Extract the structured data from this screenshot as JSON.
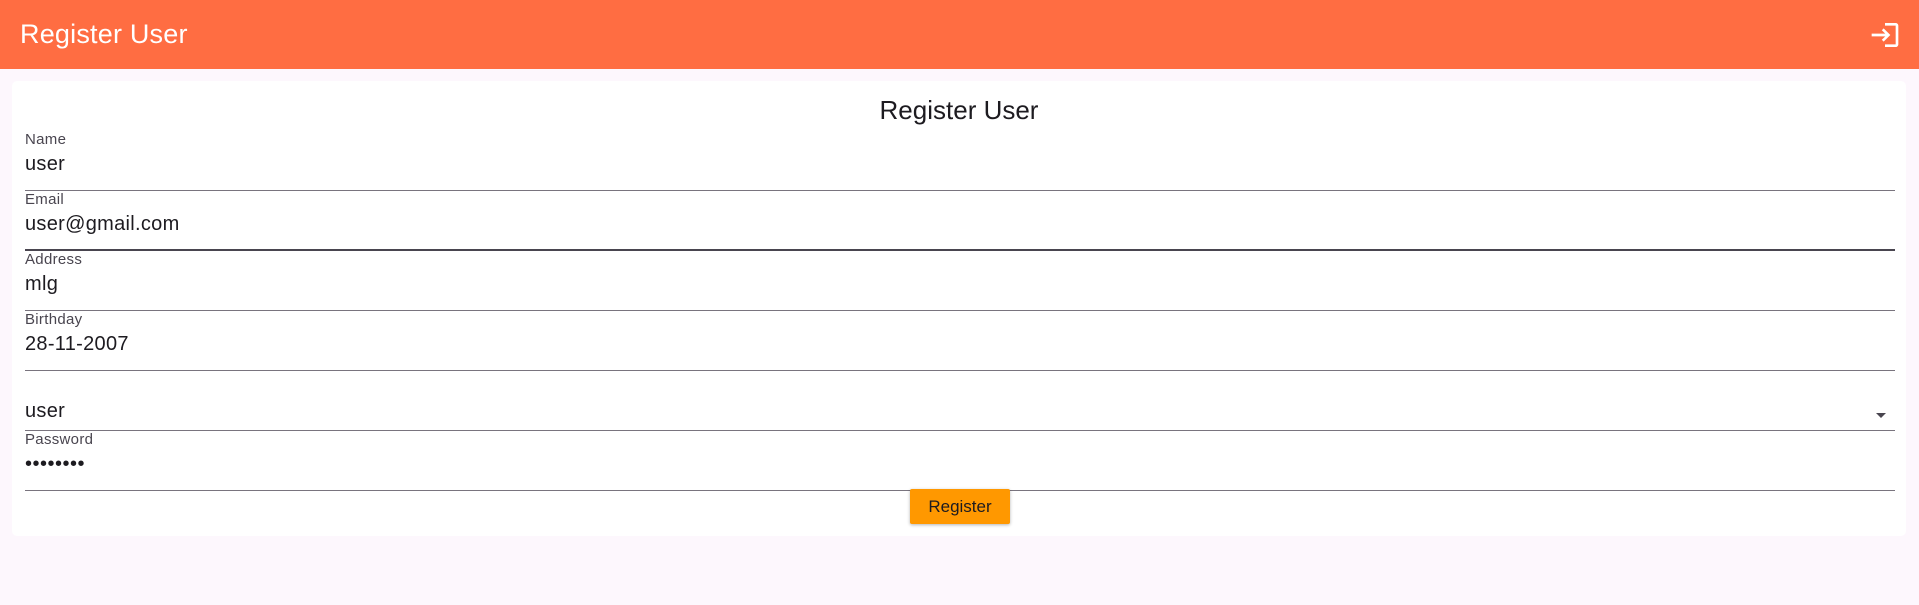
{
  "appbar": {
    "title": "Register User",
    "login_icon": "login-icon"
  },
  "form": {
    "title": "Register User",
    "fields": [
      {
        "label": "Name",
        "value": "user"
      },
      {
        "label": "Email",
        "value": "user@gmail.com"
      },
      {
        "label": "Address",
        "value": "mlg"
      },
      {
        "label": "Birthday",
        "value": "28-11-2007"
      }
    ],
    "role_select": {
      "value": "user",
      "icon": "arrow-drop-down-icon"
    },
    "password": {
      "label": "Password",
      "value": "••••••••"
    },
    "submit_label": "Register"
  },
  "colors": {
    "appbar": "#ff6d42",
    "background": "#fdf7fd",
    "button": "#ff9800"
  }
}
